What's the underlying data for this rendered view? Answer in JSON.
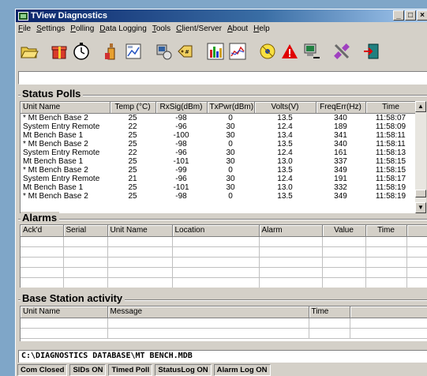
{
  "window": {
    "title": "TView Diagnostics"
  },
  "menu": [
    {
      "label": "File",
      "key": "F",
      "rest": "ile"
    },
    {
      "label": "Settings",
      "key": "S",
      "rest": "ettings"
    },
    {
      "label": "Polling",
      "key": "P",
      "rest": "olling"
    },
    {
      "label": "Data Logging",
      "key": "D",
      "rest": "ata Logging"
    },
    {
      "label": "Tools",
      "key": "T",
      "rest": "ools"
    },
    {
      "label": "Client/Server",
      "key": "C",
      "rest": "lient/Server"
    },
    {
      "label": "About",
      "key": "A",
      "rest": "bout"
    },
    {
      "label": "Help",
      "key": "H",
      "rest": "elp"
    }
  ],
  "toolbar": [
    "open-folder-icon",
    "gift-box-icon",
    "timer-icon",
    "bottle-icon",
    "image-chart-icon",
    "computer-disk-icon",
    "tag-icon",
    "bar-chart-icon",
    "line-chart-icon",
    "radio-signal-icon",
    "alert-triangle-icon",
    "network-pc-icon",
    "satellite-icon",
    "exit-door-icon"
  ],
  "colors": {
    "alert": "#e00000",
    "titlebar": "#0a246a"
  },
  "status_polls": {
    "title": "Status Polls",
    "columns": [
      "Unit Name",
      "Temp (°C)",
      "RxSig(dBm)",
      "TxPwr(dBm)",
      "Volts(V)",
      "FreqErr(Hz)",
      "Time"
    ],
    "rows": [
      [
        "* Mt Bench Base 2",
        "25",
        "-98",
        "0",
        "13.5",
        "340",
        "11:58:07"
      ],
      [
        "System Entry Remote",
        "22",
        "-96",
        "30",
        "12.4",
        "189",
        "11:58:09"
      ],
      [
        "Mt Bench Base 1",
        "25",
        "-100",
        "30",
        "13.4",
        "341",
        "11:58:11"
      ],
      [
        "* Mt Bench Base 2",
        "25",
        "-98",
        "0",
        "13.5",
        "340",
        "11:58:11"
      ],
      [
        "System Entry Remote",
        "22",
        "-96",
        "30",
        "12.4",
        "161",
        "11:58:13"
      ],
      [
        "Mt Bench Base 1",
        "25",
        "-101",
        "30",
        "13.0",
        "337",
        "11:58:15"
      ],
      [
        "* Mt Bench Base 2",
        "25",
        "-99",
        "0",
        "13.5",
        "349",
        "11:58:15"
      ],
      [
        "System Entry Remote",
        "21",
        "-96",
        "30",
        "12.4",
        "191",
        "11:58:17"
      ],
      [
        "Mt Bench Base 1",
        "25",
        "-101",
        "30",
        "13.0",
        "332",
        "11:58:19"
      ],
      [
        "* Mt Bench Base 2",
        "25",
        "-98",
        "0",
        "13.5",
        "349",
        "11:58:19"
      ]
    ]
  },
  "alarms": {
    "title": "Alarms",
    "columns": [
      "Ack'd",
      "Serial",
      "Unit Name",
      "Location",
      "Alarm",
      "Value",
      "Time"
    ]
  },
  "base_station": {
    "title": "Base Station activity",
    "columns": [
      "Unit Name",
      "Message",
      "Time"
    ]
  },
  "path": "C:\\DIAGNOSTICS DATABASE\\MT BENCH.MDB",
  "status_bar": [
    "Com Closed",
    "SIDs ON",
    "Timed Poll",
    "StatusLog ON",
    "Alarm Log ON"
  ]
}
